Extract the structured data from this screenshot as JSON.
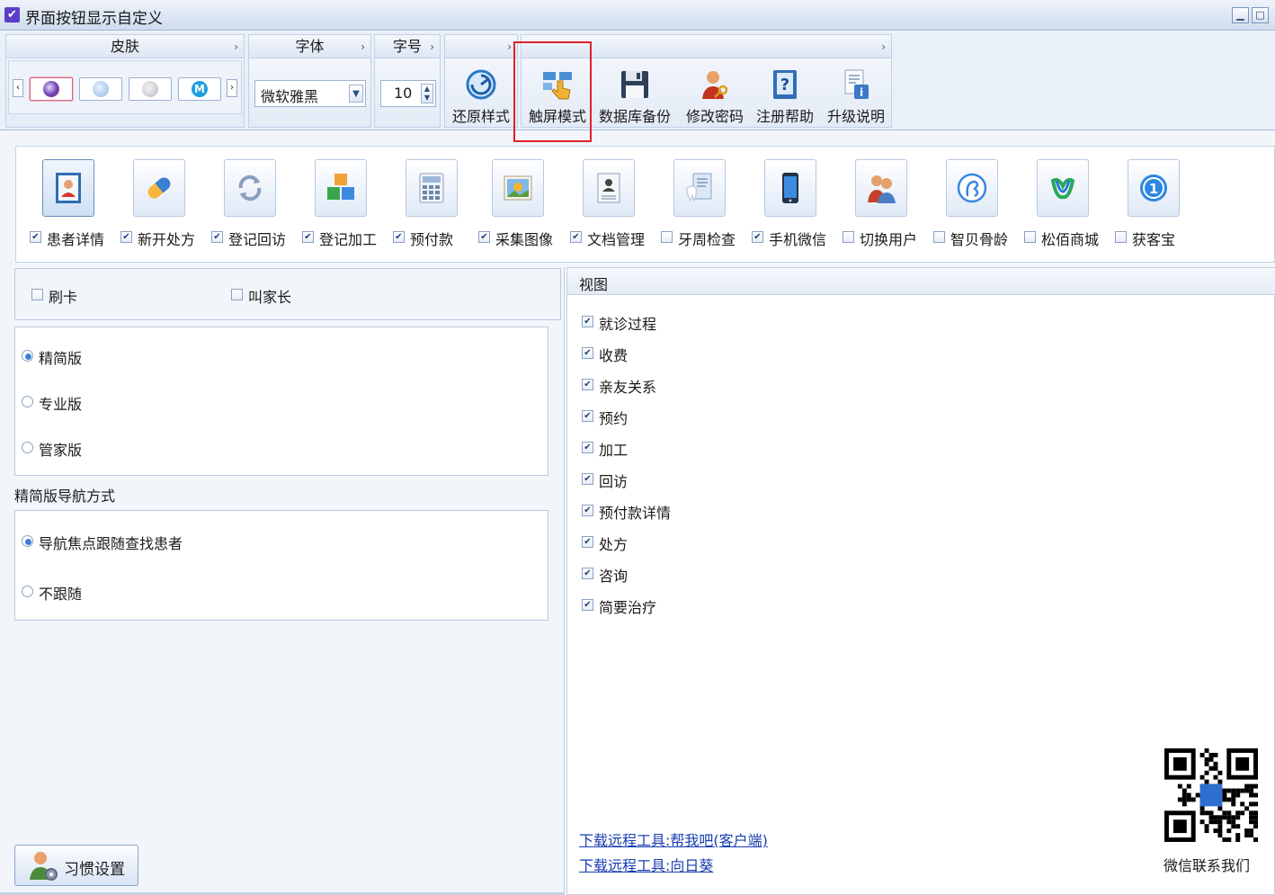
{
  "window": {
    "title": "界面按钮显示自定义",
    "min_label": "▁",
    "max_label": "□"
  },
  "ribbon": {
    "skin_group": {
      "label": "皮肤",
      "more": "›"
    },
    "font_group": {
      "label": "字体",
      "more": "›",
      "value": "微软雅黑"
    },
    "size_group": {
      "label": "字号",
      "more": "›",
      "value": "10"
    },
    "tools_group": {
      "more": "›"
    },
    "buttons": [
      {
        "label": "还原样式",
        "icon": "restore-icon"
      },
      {
        "label": "触屏模式",
        "icon": "touch-icon"
      },
      {
        "label": "数据库备份",
        "icon": "floppy-icon"
      },
      {
        "label": "修改密码",
        "icon": "user-key-icon"
      },
      {
        "label": "注册帮助",
        "icon": "help-book-icon"
      },
      {
        "label": "升级说明",
        "icon": "info-doc-icon"
      }
    ],
    "highlight_color": "#e0212b"
  },
  "nav": {
    "items": [
      {
        "label": "患者详情",
        "checked": true,
        "icon": "patient-card-icon"
      },
      {
        "label": "新开处方",
        "checked": true,
        "icon": "pill-icon"
      },
      {
        "label": "登记回访",
        "checked": true,
        "icon": "refresh-icon"
      },
      {
        "label": "登记加工",
        "checked": true,
        "icon": "cubes-icon"
      },
      {
        "label": "预付款",
        "checked": true,
        "icon": "calculator-icon"
      },
      {
        "label": "采集图像",
        "checked": true,
        "icon": "picture-icon"
      },
      {
        "label": "文档管理",
        "checked": true,
        "icon": "document-icon"
      },
      {
        "label": "牙周检查",
        "checked": false,
        "icon": "tooth-clipboard-icon"
      },
      {
        "label": "手机微信",
        "checked": true,
        "icon": "phone-icon"
      },
      {
        "label": "切换用户",
        "checked": false,
        "icon": "users-icon"
      },
      {
        "label": "智贝骨龄",
        "checked": false,
        "icon": "zhibei-logo-icon"
      },
      {
        "label": "松佰商城",
        "checked": false,
        "icon": "songbai-logo-icon"
      },
      {
        "label": "获客宝",
        "checked": false,
        "icon": "huokebao-logo-icon"
      }
    ]
  },
  "options": {
    "swipe_card": {
      "label": "刷卡",
      "checked": false
    },
    "call_parent": {
      "label": "叫家长",
      "checked": false
    }
  },
  "edition": {
    "options": [
      {
        "label": "精简版",
        "selected": true
      },
      {
        "label": "专业版",
        "selected": false
      },
      {
        "label": "管家版",
        "selected": false
      }
    ]
  },
  "nav_mode": {
    "title": "精简版导航方式",
    "options": [
      {
        "label": "导航焦点跟随查找患者",
        "selected": true
      },
      {
        "label": "不跟随",
        "selected": false
      }
    ]
  },
  "view": {
    "title": "视图",
    "items": [
      {
        "label": "就诊过程",
        "checked": true
      },
      {
        "label": "收费",
        "checked": true
      },
      {
        "label": "亲友关系",
        "checked": true
      },
      {
        "label": "预约",
        "checked": true
      },
      {
        "label": "加工",
        "checked": true
      },
      {
        "label": "回访",
        "checked": true
      },
      {
        "label": "预付款详情",
        "checked": true
      },
      {
        "label": "处方",
        "checked": true
      },
      {
        "label": "咨询",
        "checked": true
      },
      {
        "label": "简要治疗",
        "checked": true
      }
    ],
    "links": [
      "下载远程工具:帮我吧(客户端)",
      "下载远程工具:向日葵"
    ],
    "qr_caption": "微信联系我们"
  },
  "footer": {
    "habit_button": "习惯设置"
  }
}
